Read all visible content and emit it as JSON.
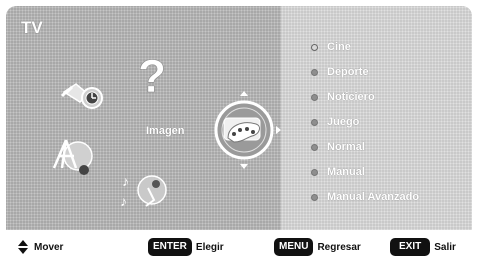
{
  "title": "TV",
  "center_label": "Imagen",
  "picture_modes": [
    {
      "label": "Cine",
      "selected": true
    },
    {
      "label": "Deporte",
      "selected": false
    },
    {
      "label": "Noticiero",
      "selected": false
    },
    {
      "label": "Juego",
      "selected": false
    },
    {
      "label": "Normal",
      "selected": false
    },
    {
      "label": "Manual",
      "selected": false
    },
    {
      "label": "Manual Avanzado",
      "selected": false
    }
  ],
  "footer": {
    "move_label": "Mover",
    "enter_key": "ENTER",
    "enter_label": "Elegir",
    "menu_key": "MENU",
    "menu_label": "Regresar",
    "exit_key": "EXIT",
    "exit_label": "Salir"
  },
  "icons": [
    "settings-clock-icon",
    "help-question-icon",
    "antenna-icon",
    "audio-speaker-icon",
    "picture-palette-icon",
    "up-arrow-icon",
    "down-arrow-icon",
    "right-arrow-icon",
    "up-down-arrows-icon"
  ]
}
